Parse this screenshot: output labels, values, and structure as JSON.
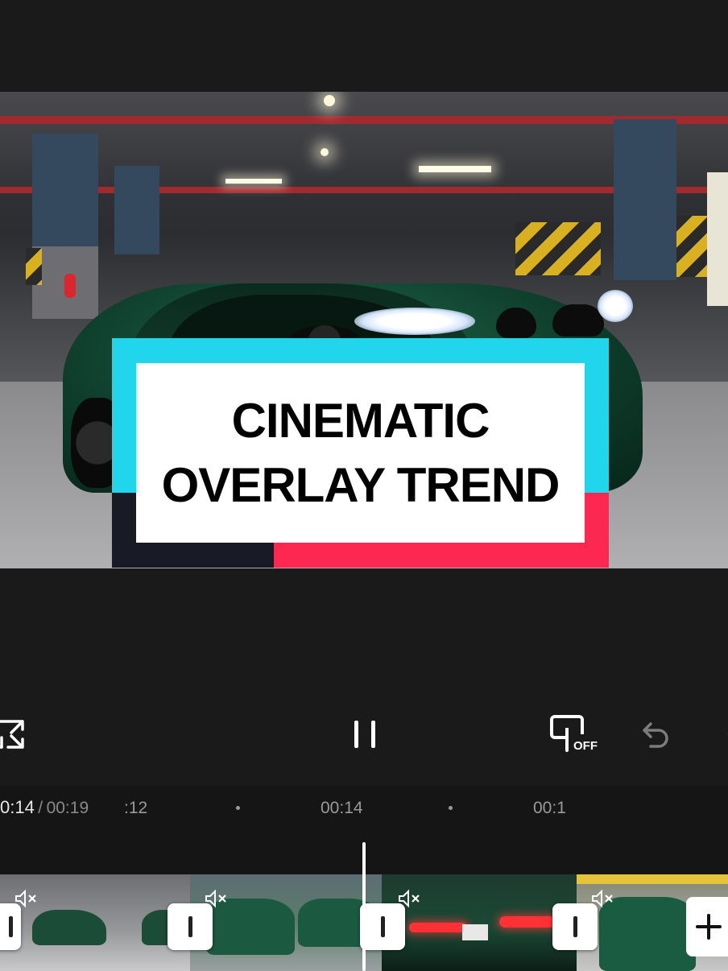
{
  "preview": {
    "overlay_title": {
      "line1": "CINEMATIC",
      "line2": "OVERLAY TREND"
    },
    "colors": {
      "cyan": "#21d6ec",
      "pink": "#fc2851",
      "dark": "#181a26",
      "white": "#ffffff"
    }
  },
  "toolbar": {
    "fullscreen_icon": "fullscreen-icon",
    "play_state_icon": "pause-icon",
    "keyframe_off_label": "OFF",
    "undo_icon": "undo-icon",
    "redo_icon": "redo-icon"
  },
  "timeline": {
    "current_time": "0:14",
    "separator": "/",
    "total_time": "00:19",
    "ruler_labels": [
      ":12",
      "00:14",
      "00:1"
    ],
    "clips": [
      {
        "muted": true
      },
      {
        "muted": true
      },
      {
        "muted": true
      },
      {
        "muted": true
      }
    ],
    "add_clip_icon": "plus-icon"
  }
}
